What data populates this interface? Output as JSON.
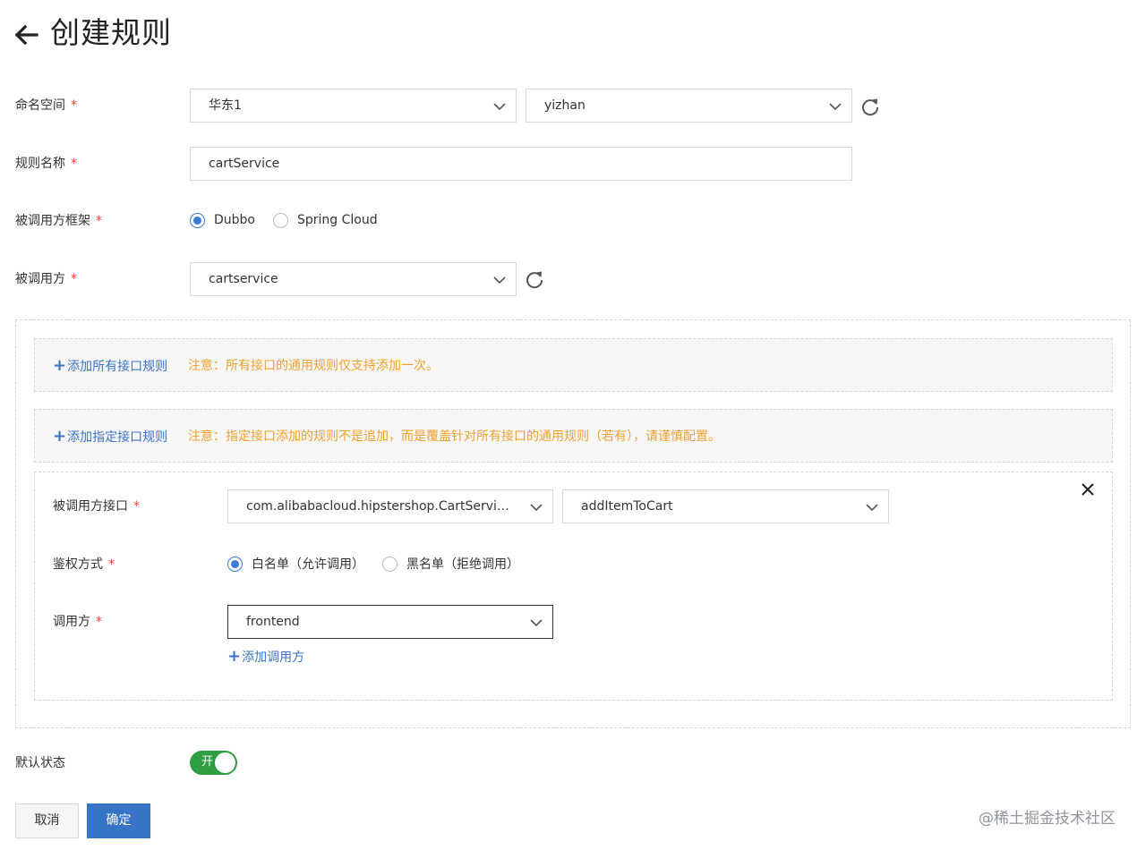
{
  "header": {
    "title": "创建规则"
  },
  "namespace": {
    "label": "命名空间",
    "region": "华东1",
    "namespace": "yizhan"
  },
  "rule_name": {
    "label": "规则名称",
    "value": "cartService"
  },
  "framework": {
    "label": "被调用方框架",
    "options": [
      "Dubbo",
      "Spring Cloud"
    ],
    "selected": "Dubbo"
  },
  "callee": {
    "label": "被调用方",
    "value": "cartservice"
  },
  "required_mark": "*",
  "all_interface_rule": {
    "add_label": "添加所有接口规则",
    "note": "注意：所有接口的通用规则仅支持添加一次。"
  },
  "specific_interface_rule": {
    "add_label": "添加指定接口规则",
    "note": "注意：指定接口添加的规则不是追加，而是覆盖针对所有接口的通用规则（若有），请谨慎配置。"
  },
  "interface_rule": {
    "interface_label": "被调用方接口",
    "interface_value": "com.alibabacloud.hipstershop.CartServic...",
    "method_value": "addItemToCart",
    "auth_label": "鉴权方式",
    "auth_options": [
      "白名单（允许调用）",
      "黑名单（拒绝调用）"
    ],
    "auth_selected": "白名单（允许调用）",
    "caller_label": "调用方",
    "caller_value": "frontend",
    "add_caller_label": "添加调用方"
  },
  "default_state": {
    "label": "默认状态",
    "toggle_text": "开",
    "on": true
  },
  "footer": {
    "cancel_label": "取消",
    "confirm_label": "确定"
  },
  "watermark": "@稀土掘金技术社区",
  "colors": {
    "primary": "#3574c7",
    "link": "#3b74c8",
    "warning": "#f0a12e",
    "required": "#e84738",
    "toggle_on": "#2f9e42"
  }
}
